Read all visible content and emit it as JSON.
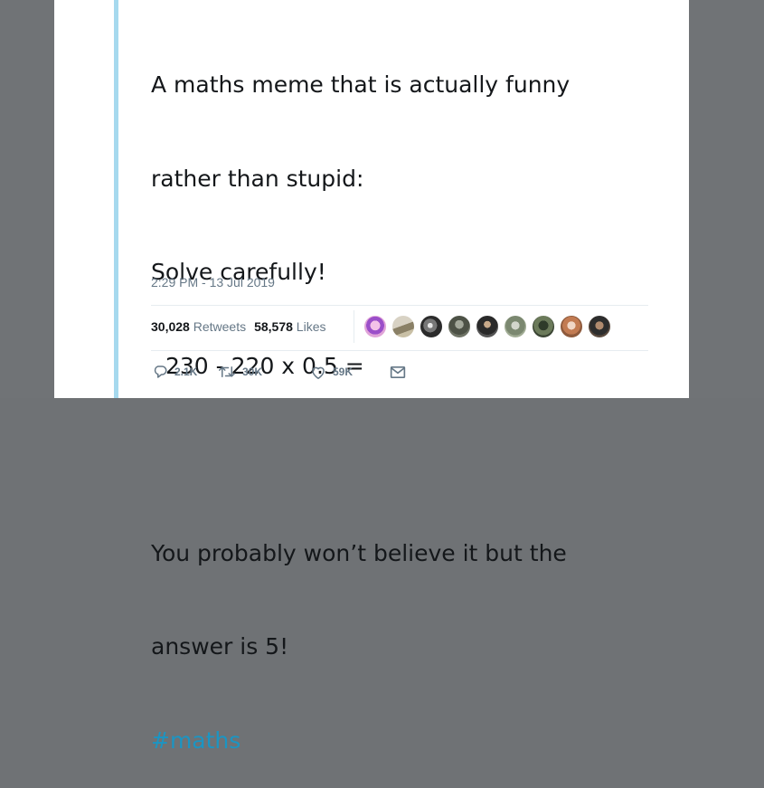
{
  "tweet": {
    "lines": [
      "A maths meme that is actually funny",
      "rather than stupid:",
      "Solve carefully!",
      "230 - 220 x 0.5 =",
      "",
      "You probably won’t believe it but the",
      "answer is 5!"
    ],
    "hashtag": "#maths",
    "timestamp": "2:29 PM - 13 Jul 2019"
  },
  "stats": {
    "retweets_count": "30,028",
    "retweets_label": "Retweets",
    "likes_count": "58,578",
    "likes_label": "Likes"
  },
  "actions": {
    "reply_count": "2.1K",
    "retweet_count": "30K",
    "like_count": "59K"
  },
  "colors": {
    "accent_bar": "#a6d9ee",
    "hashtag": "#1b95c3",
    "muted_text": "#657786",
    "body_text": "#14171a"
  },
  "icons": [
    "reply-icon",
    "retweet-icon",
    "like-icon",
    "direct-message-icon"
  ]
}
